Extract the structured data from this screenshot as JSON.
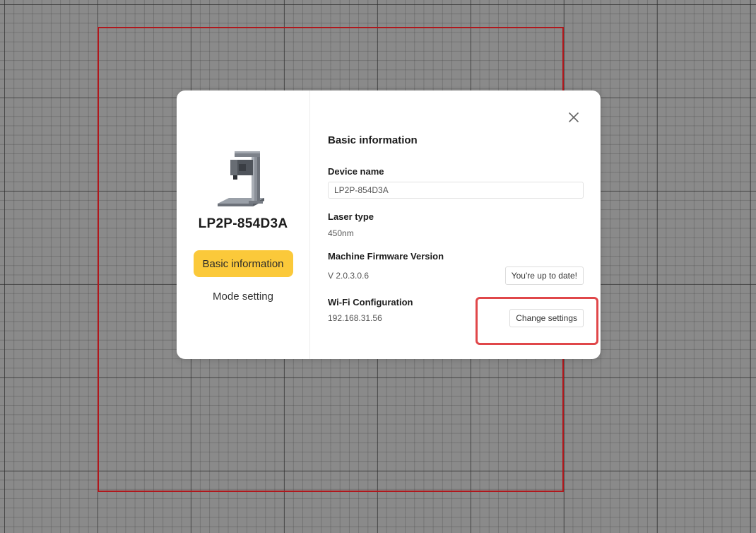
{
  "dialog": {
    "device_title": "LP2P-854D3A",
    "nav": {
      "basic_label": "Basic information",
      "mode_label": "Mode setting"
    },
    "section_title": "Basic information",
    "device_name": {
      "label": "Device name",
      "value": "LP2P-854D3A"
    },
    "laser_type": {
      "label": "Laser type",
      "value": "450nm"
    },
    "firmware": {
      "label": "Machine Firmware Version",
      "value": "V 2.0.3.0.6",
      "status_button": "You're up to date!"
    },
    "wifi": {
      "label": "Wi-Fi Configuration",
      "value": "192.168.31.56",
      "button": "Change settings"
    }
  },
  "icons": {
    "close": "close-icon",
    "device": "laser-engraver-device-image"
  },
  "colors": {
    "accent": "#fbc93a",
    "work_area_border": "#b0171c",
    "highlight": "#e0474a"
  }
}
